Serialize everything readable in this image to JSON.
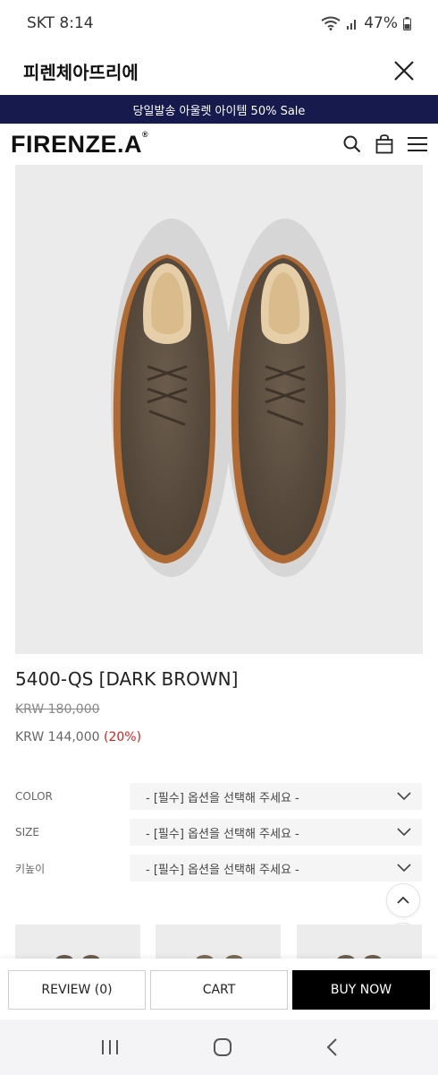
{
  "status_bar": {
    "carrier_time": "SKT 8:14",
    "battery": "47%",
    "icons": [
      "wifi-icon",
      "signal-icon",
      "battery-icon"
    ]
  },
  "app_header": {
    "title": "피렌체아뜨리에",
    "close_icon": "close-icon"
  },
  "promo": {
    "text": "당일발송 아울렛 아이템 50% Sale"
  },
  "site_header": {
    "logo": "FIRENZE.A",
    "logo_mark": "®",
    "icons": [
      "search-icon",
      "shopping-bag-icon",
      "menu-icon"
    ]
  },
  "product": {
    "title": "5400-QS [DARK BROWN]",
    "original_price": "KRW 180,000",
    "sale_price": "KRW 144,000",
    "discount": "(20%)"
  },
  "options": [
    {
      "label": "COLOR",
      "placeholder": "- [필수] 옵션을 선택해 주세요 -"
    },
    {
      "label": "SIZE",
      "placeholder": "- [필수] 옵션을 선택해 주세요 -"
    },
    {
      "label": "키높이",
      "placeholder": "- [필수] 옵션을 선택해 주세요 -"
    }
  ],
  "bottom_bar": {
    "review": "REVIEW (0)",
    "cart": "CART",
    "buy": "BUY NOW"
  },
  "colors": {
    "promo_bg": "#161a4c",
    "discount": "#d42020",
    "buy_bg": "#000000",
    "image_bg": "#ebebeb"
  }
}
